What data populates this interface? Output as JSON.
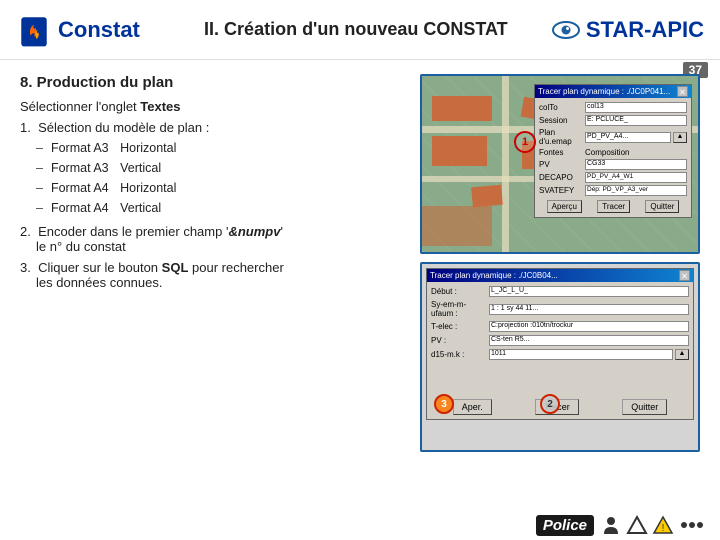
{
  "header": {
    "constat_label": "Constat",
    "title": "II.  Création d'un nouveau CONSTAT",
    "star_apic_label": "STAR-APIC"
  },
  "page_number": "37",
  "section": {
    "heading": "8. Production du plan",
    "subheading_pre": "Sélectionner l'onglet ",
    "subheading_bold": "Textes"
  },
  "list_items": [
    {
      "number": "1.",
      "text": "Sélection du modèle de plan :",
      "sub_items": [
        {
          "dash": "–",
          "format": "Format A3",
          "type": "Horizontal"
        },
        {
          "dash": "–",
          "format": "Format A3",
          "type": "Vertical"
        },
        {
          "dash": "–",
          "format": "Format A4",
          "type": "Horizontal"
        },
        {
          "dash": "–",
          "format": "Format A4",
          "type": "Vertical"
        }
      ]
    },
    {
      "number": "2.",
      "text_pre": "Encoder dans le premier champ '",
      "text_code": "&numpv",
      "text_post": "'",
      "sub_text": "le n° du constat"
    },
    {
      "number": "3.",
      "text_pre": "Cliquer sur le bouton ",
      "text_bold": "SQL",
      "text_post": " pour rechercher",
      "sub_text": "les données connues."
    }
  ],
  "dialog_top": {
    "title": "Tracer plan dynamique : ./JC0P041...",
    "fields": [
      {
        "label": "colTo",
        "value": "col13"
      },
      {
        "label": "Session",
        "value": "E: PCLUCE_"
      },
      {
        "label": "Plan d'u.emap",
        "value": "PD_PV_A4..."
      },
      {
        "label": "Fontes Composition",
        "value": ""
      },
      {
        "label": "PV",
        "value": "CG33"
      },
      {
        "label": "DECAPO",
        "value": "PD_PV_A4_W1"
      },
      {
        "label": "SVATEFY",
        "value": "Dép: PD_VP_A3_ver"
      }
    ],
    "buttons": [
      "Aperçu",
      "Tracer",
      "Quitter"
    ],
    "marker": "1"
  },
  "dialog_bottom": {
    "title": "Tracer plan dynamique : ./JC0B04...",
    "fields": [
      {
        "label": "Début :",
        "value": "L_JC_L_U_"
      },
      {
        "label": "Sy-em-m-ufaum :",
        "value": "1 : 1 sy 44 11..."
      },
      {
        "label": "T-elec :",
        "value": "C:projection :010tn/trockur"
      },
      {
        "label": "PV :",
        "value": "CS-ten R5..."
      },
      {
        "label": "d15-m.k :",
        "value": "1011"
      }
    ],
    "buttons": [
      "Aper.",
      "Tracer",
      "Quitter"
    ],
    "markers": [
      "2",
      "3"
    ]
  },
  "footer": {
    "police_label": "Police",
    "icons": [
      "person-icon",
      "triangle-icon",
      "dots-icon"
    ]
  }
}
